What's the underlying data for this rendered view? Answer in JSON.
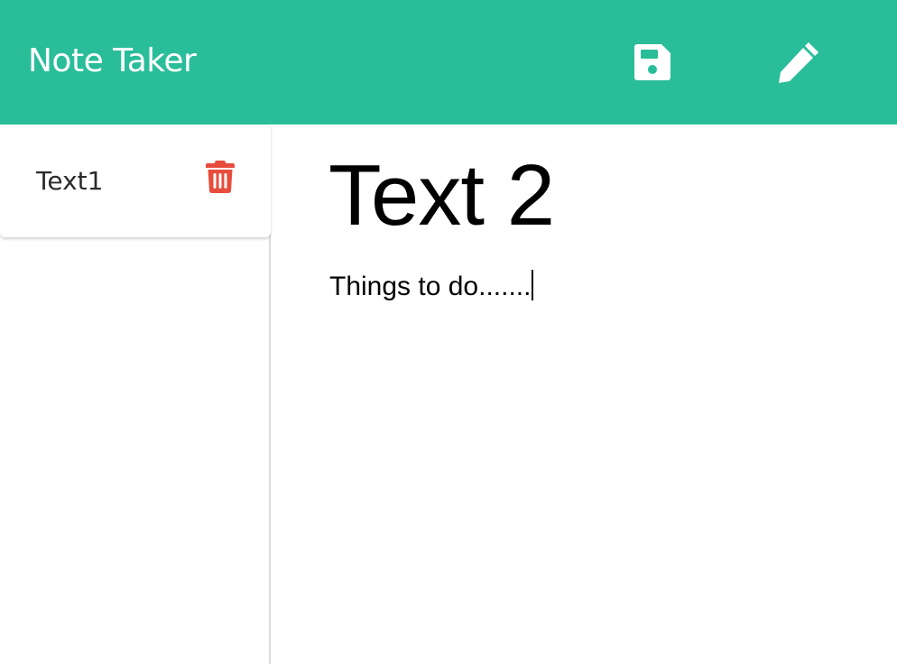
{
  "navbar": {
    "brand": "Note Taker",
    "save_icon": "save-icon",
    "edit_icon": "pencil-icon",
    "background_color": "#2abd9a"
  },
  "sidebar": {
    "notes": [
      {
        "title": "Text1",
        "delete_icon": "trash-icon"
      }
    ],
    "delete_color": "#e74c3c"
  },
  "editor": {
    "title": "Text 2",
    "body": "Things to do......."
  }
}
